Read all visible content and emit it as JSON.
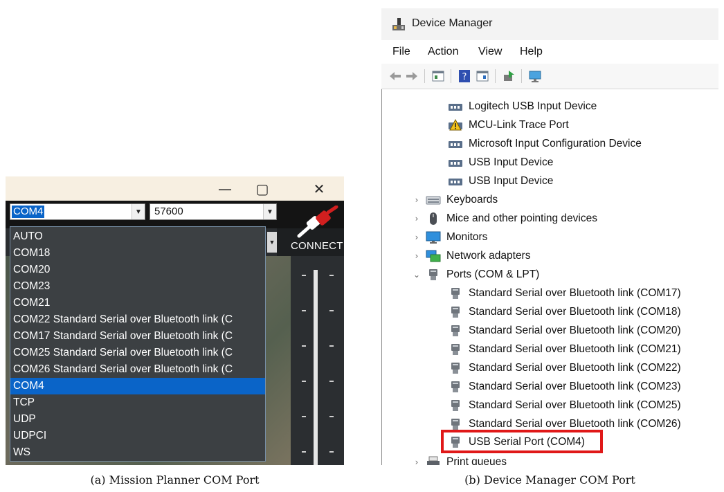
{
  "mission_planner": {
    "window_controls": {
      "minimize": "—",
      "restore": "▢",
      "close": "✕"
    },
    "com_port": {
      "value": "COM4",
      "dropdown_arrow": "▼"
    },
    "baud_rate": {
      "value": "57600",
      "dropdown_arrow": "▼"
    },
    "connect_label": "CONNECT",
    "com_options": [
      "AUTO",
      "COM18",
      "COM20",
      "COM23",
      "COM21",
      "COM22 Standard Serial over Bluetooth link (C",
      "COM17 Standard Serial over Bluetooth link (C",
      "COM25 Standard Serial over Bluetooth link (C",
      "COM26 Standard Serial over Bluetooth link (C",
      "COM4",
      "TCP",
      "UDP",
      "UDPCI",
      "WS"
    ],
    "selected_option": "COM4"
  },
  "device_manager": {
    "title": "Device Manager",
    "menu": [
      "File",
      "Action",
      "View",
      "Help"
    ],
    "tree": {
      "hid_children": [
        "Logitech USB Input Device",
        "MCU-Link Trace Port",
        "Microsoft Input Configuration Device",
        "USB Input Device",
        "USB Input Device"
      ],
      "categories": {
        "keyboards": "Keyboards",
        "mice": "Mice and other pointing devices",
        "monitors": "Monitors",
        "network": "Network adapters",
        "ports": "Ports (COM & LPT)",
        "print_queues": "Print queues"
      },
      "ports_children": [
        "Standard Serial over Bluetooth link (COM17)",
        "Standard Serial over Bluetooth link (COM18)",
        "Standard Serial over Bluetooth link (COM20)",
        "Standard Serial over Bluetooth link (COM21)",
        "Standard Serial over Bluetooth link (COM22)",
        "Standard Serial over Bluetooth link (COM23)",
        "Standard Serial over Bluetooth link (COM25)",
        "Standard Serial over Bluetooth link (COM26)",
        "USB Serial Port (COM4)"
      ],
      "chevron_collapsed": "›",
      "chevron_expanded": "⌄"
    },
    "highlight_color": "#e01818"
  },
  "captions": {
    "a": "(a) Mission Planner COM Port",
    "b": "(b) Device Manager COM Port"
  },
  "icons": {
    "hid": "hid-device-icon",
    "warning": "warning-hid-icon",
    "port": "serial-port-icon"
  }
}
